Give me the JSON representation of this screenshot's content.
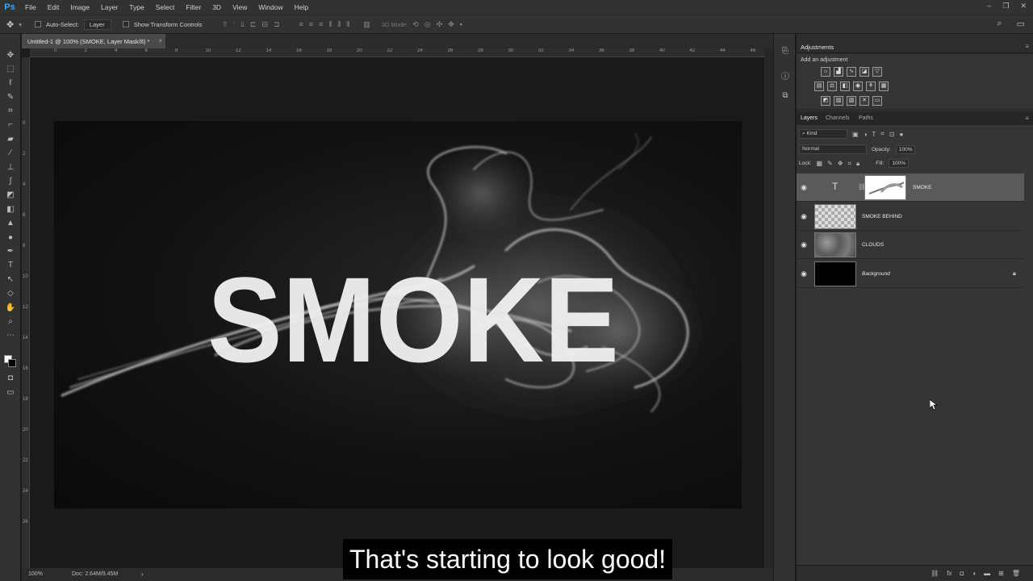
{
  "app": {
    "logo": "Ps"
  },
  "menubar": {
    "items": [
      "File",
      "Edit",
      "Image",
      "Layer",
      "Type",
      "Select",
      "Filter",
      "3D",
      "View",
      "Window",
      "Help"
    ]
  },
  "options": {
    "auto_select_label": "Auto-Select:",
    "auto_select_value": "Layer",
    "show_transform_label": "Show Transform Controls",
    "mode_label": "3D Mode:"
  },
  "document": {
    "tab_title": "Untitled-1 @ 100% (SMOKE, Layer Mask/8) *",
    "close_glyph": "×"
  },
  "canvas": {
    "text": "SMOKE"
  },
  "rulers": {
    "horizontal": [
      "0",
      "2",
      "4",
      "6",
      "8",
      "10",
      "12",
      "14",
      "16",
      "18",
      "20",
      "22",
      "24",
      "26",
      "28",
      "30",
      "32",
      "34",
      "36",
      "38",
      "40",
      "42",
      "44",
      "46"
    ],
    "vertical": [
      "0",
      "2",
      "4",
      "6",
      "8",
      "10",
      "12",
      "14",
      "16",
      "18",
      "20",
      "22",
      "24",
      "26"
    ]
  },
  "statusbar": {
    "zoom": "100%",
    "doc": "Doc: 2.64M/9.45M",
    "arrow": "›"
  },
  "subtitle": "That's starting to look good!",
  "adjustments": {
    "title": "Adjustments",
    "subtitle": "Add an adjustment"
  },
  "layers_panel": {
    "tabs": [
      "Layers",
      "Channels",
      "Paths"
    ],
    "kind_label": "Kind",
    "blend_mode": "Normal",
    "opacity_label": "Opacity:",
    "opacity_value": "100%",
    "lock_label": "Lock:",
    "fill_label": "Fill:",
    "fill_value": "100%",
    "layers": [
      {
        "name": "SMOKE",
        "type": "text-with-mask",
        "visible": true,
        "selected": true
      },
      {
        "name": "SMOKE BEHIND",
        "type": "transparent",
        "visible": true,
        "selected": false
      },
      {
        "name": "CLOUDS",
        "type": "clouds",
        "visible": true,
        "selected": false
      },
      {
        "name": "Background",
        "type": "black",
        "visible": true,
        "selected": false,
        "locked": true
      }
    ]
  },
  "icons": {
    "eye": "eye-icon",
    "lock": "lock-icon"
  }
}
